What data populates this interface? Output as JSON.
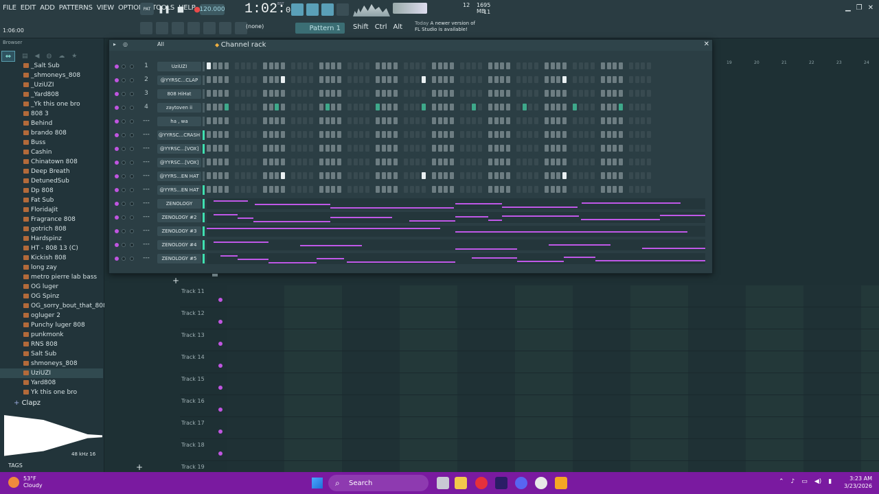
{
  "menu": [
    "FILE",
    "EDIT",
    "ADD",
    "PATTERNS",
    "VIEW",
    "OPTIONS",
    "TOOLS",
    "HELP"
  ],
  "hint": "1:06:00",
  "transport": {
    "mode": "PAT",
    "tempo": "120.000",
    "time_main": "1:02",
    "time_sub": "04",
    "time_label": "BST"
  },
  "cpu": {
    "ram": "1695 MB",
    "polyphony": "12",
    "cpu_small": "11"
  },
  "toolbar": {
    "snap": "(none)",
    "pattern": "Pattern 1",
    "shift": "Shift",
    "ctrl": "Ctrl",
    "alt": "Alt"
  },
  "news": {
    "when": "Today",
    "line1": "A newer version of",
    "line2": "FL Studio is available!"
  },
  "browser": {
    "title": "Browser",
    "folders": [
      "_Salt Sub",
      "_shmoneys_808",
      "_UziUZI",
      "_Yard808",
      "_Yk this one bro",
      "808 3",
      "Behind",
      "brando 808",
      "Buss",
      "Cashin",
      "Chinatown 808",
      "Deep Breath",
      "DetunedSub",
      "Dp 808",
      "Fat Sub",
      "FloridaJit",
      "Fragrance 808",
      "gotrich 808",
      "Hardspinz",
      "HT - 808 13 (C)",
      "Kickish 808",
      "long zay",
      "metro pierre lab bass",
      "OG luger",
      "OG Spinz",
      "OG_sorry_bout_that_808",
      "ogluger 2",
      "Punchy luger 808",
      "punkmonk",
      "RNS 808",
      "Salt Sub",
      "shmoneys_808",
      "UziUZI",
      "Yard808",
      "Yk this one bro"
    ],
    "selected_folder": "UziUZI",
    "preview_title": "Clapz",
    "sample_info": "48 kHz 16",
    "tags": "TAGS"
  },
  "rack": {
    "title": "Channel rack",
    "filter": "All",
    "channels": [
      {
        "num": "1",
        "name": "UziUZI",
        "type": "steps",
        "sel": false
      },
      {
        "num": "2",
        "name": "@YYRSC...CLAP",
        "type": "steps",
        "sel": false
      },
      {
        "num": "3",
        "name": "808 HiHat",
        "type": "steps",
        "sel": false
      },
      {
        "num": "4",
        "name": "zaytoven ii",
        "type": "steps",
        "sel": false
      },
      {
        "num": "---",
        "name": "ha , wa",
        "type": "steps",
        "sel": false
      },
      {
        "num": "---",
        "name": "@YYRSC...CRASH",
        "type": "steps",
        "sel": true
      },
      {
        "num": "---",
        "name": "@YYRSC...[VOX]",
        "type": "steps",
        "sel": true
      },
      {
        "num": "---",
        "name": "@YYRSC...[VOX]",
        "type": "steps",
        "sel": false
      },
      {
        "num": "---",
        "name": "@YYRS...EN HAT",
        "type": "steps",
        "sel": false
      },
      {
        "num": "---",
        "name": "@YYRS...EN HAT",
        "type": "steps",
        "sel": true
      },
      {
        "num": "---",
        "name": "ZENOLOGY",
        "type": "piano",
        "sel": true
      },
      {
        "num": "---",
        "name": "ZENOLOGY #2",
        "type": "piano",
        "sel": true
      },
      {
        "num": "---",
        "name": "ZENOLOGY #3",
        "type": "piano",
        "sel": true
      },
      {
        "num": "---",
        "name": "ZENOLOGY #4",
        "type": "piano",
        "sel": true
      },
      {
        "num": "---",
        "name": "ZENOLOGY #5",
        "type": "piano",
        "sel": true
      }
    ]
  },
  "playlist": {
    "ruler": [
      "19",
      "20",
      "21",
      "22",
      "23",
      "24"
    ],
    "tracks": [
      "Track 11",
      "Track 12",
      "Track 13",
      "Track 14",
      "Track 15",
      "Track 16",
      "Track 17",
      "Track 18",
      "Track 19"
    ]
  },
  "taskbar": {
    "temp": "53°F",
    "weather": "Cloudy",
    "search": "Search",
    "time": "3:23 AM",
    "date": "3/23/2026"
  }
}
